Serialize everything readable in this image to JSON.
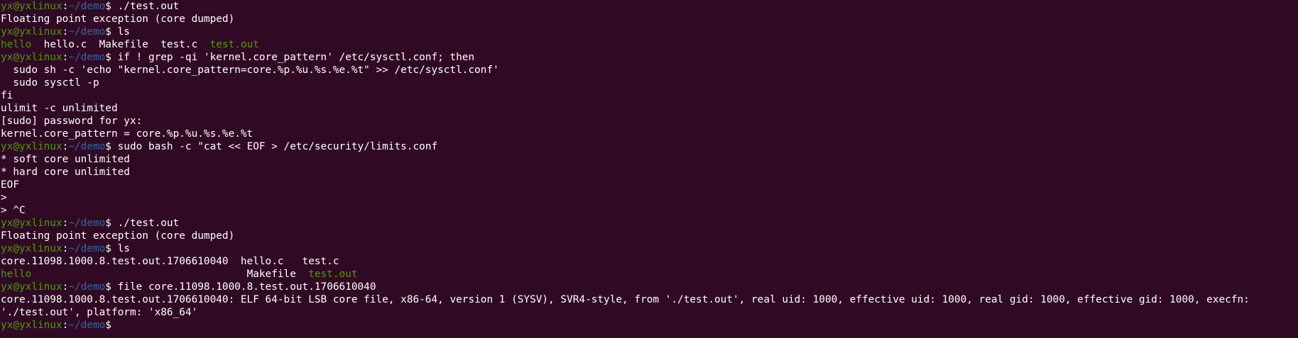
{
  "colors": {
    "background": "#300a24",
    "text": "#ffffff",
    "prompt_user": "#4e9a06",
    "prompt_path": "#3465a4",
    "executable": "#4e9a06"
  },
  "prompt": {
    "user_host": "yx@yxlinux",
    "separator": ":",
    "path": "~/demo",
    "symbol": "$"
  },
  "lines": [
    {
      "type": "prompt",
      "cmd": "./test.out"
    },
    {
      "type": "output",
      "text": "Floating point exception (core dumped)"
    },
    {
      "type": "prompt",
      "cmd": "ls"
    },
    {
      "type": "ls1",
      "items": [
        {
          "text": "hello",
          "exec": true
        },
        {
          "text": "  hello.c  Makefile  test.c  ",
          "exec": false
        },
        {
          "text": "test.out",
          "exec": true
        }
      ]
    },
    {
      "type": "prompt",
      "cmd": "if ! grep -qi 'kernel.core_pattern' /etc/sysctl.conf; then"
    },
    {
      "type": "output",
      "text": "  sudo sh -c 'echo \"kernel.core_pattern=core.%p.%u.%s.%e.%t\" >> /etc/sysctl.conf'"
    },
    {
      "type": "output",
      "text": "  sudo sysctl -p"
    },
    {
      "type": "output",
      "text": "fi"
    },
    {
      "type": "output",
      "text": "ulimit -c unlimited"
    },
    {
      "type": "output",
      "text": "[sudo] password for yx:"
    },
    {
      "type": "output",
      "text": "kernel.core_pattern = core.%p.%u.%s.%e.%t"
    },
    {
      "type": "prompt",
      "cmd": "sudo bash -c \"cat << EOF > /etc/security/limits.conf"
    },
    {
      "type": "output",
      "text": "* soft core unlimited"
    },
    {
      "type": "output",
      "text": "* hard core unlimited"
    },
    {
      "type": "output",
      "text": "EOF"
    },
    {
      "type": "output",
      "text": ">"
    },
    {
      "type": "output",
      "text": "> ^C"
    },
    {
      "type": "prompt",
      "cmd": "./test.out"
    },
    {
      "type": "output",
      "text": "Floating point exception (core dumped)"
    },
    {
      "type": "prompt",
      "cmd": "ls"
    },
    {
      "type": "ls1",
      "items": [
        {
          "text": "core.11098.1000.8.test.out.1706610040  hello.c   test.c",
          "exec": false
        }
      ]
    },
    {
      "type": "ls1",
      "items": [
        {
          "text": "hello",
          "exec": true
        },
        {
          "text": "                                   Makefile  ",
          "exec": false
        },
        {
          "text": "test.out",
          "exec": true
        }
      ]
    },
    {
      "type": "prompt",
      "cmd": "file core.11098.1000.8.test.out.1706610040"
    },
    {
      "type": "output",
      "text": "core.11098.1000.8.test.out.1706610040: ELF 64-bit LSB core file, x86-64, version 1 (SYSV), SVR4-style, from './test.out', real uid: 1000, effective uid: 1000, real gid: 1000, effective gid: 1000, execfn:"
    },
    {
      "type": "output",
      "text": "'./test.out', platform: 'x86_64'"
    },
    {
      "type": "prompt",
      "cmd": ""
    }
  ]
}
